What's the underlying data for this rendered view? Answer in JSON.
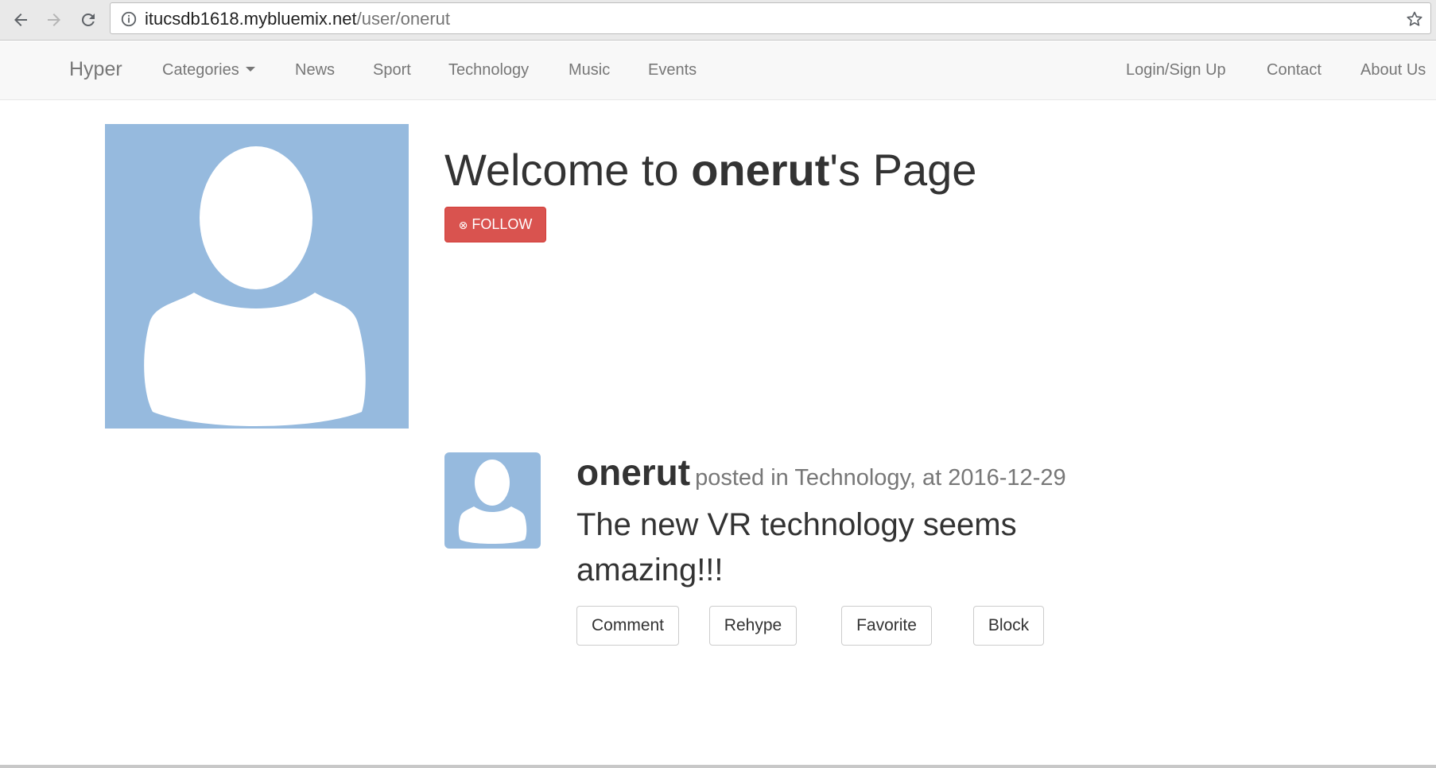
{
  "browser": {
    "url_host": "itucsdb1618.mybluemix.net",
    "url_path": "/user/onerut"
  },
  "navbar": {
    "brand": "Hyper",
    "left_items": [
      {
        "label": "Categories"
      },
      {
        "label": "News"
      },
      {
        "label": "Sport"
      },
      {
        "label": "Technology"
      },
      {
        "label": "Music"
      },
      {
        "label": "Events"
      }
    ],
    "right_items": [
      {
        "label": "Login/Sign Up"
      },
      {
        "label": "Contact"
      },
      {
        "label": "About Us"
      }
    ]
  },
  "profile": {
    "welcome_prefix": "Welcome to ",
    "username": "onerut",
    "welcome_suffix": "'s Page",
    "follow_label": "FOLLOW",
    "follow_icon": "⊗"
  },
  "post": {
    "author": "onerut",
    "meta": "posted in Technology, at 2016-12-29",
    "text": "The new VR technology seems amazing!!!",
    "actions": {
      "comment": "Comment",
      "rehype": "Rehype",
      "favorite": "Favorite",
      "block": "Block"
    }
  },
  "colors": {
    "avatar_bg": "#96bade",
    "follow_btn": "#d9534f",
    "navbar_bg": "#f8f8f8"
  }
}
